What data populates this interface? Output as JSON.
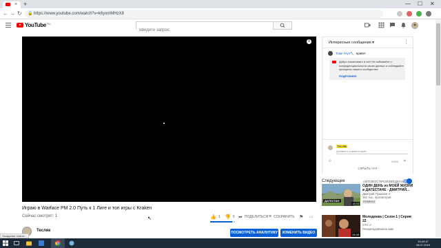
{
  "browser": {
    "url": "https://www.youtube.com/watch?v=k6yxmMHzX8",
    "new_tab": "+",
    "tab_close": "×",
    "nav": {
      "back": "←",
      "forward": "→",
      "reload": "↻",
      "lock": "🔒"
    },
    "window": {
      "minimize": "—",
      "maximize": "☐",
      "close": "✕"
    }
  },
  "youtube": {
    "logo_text": "YouTube",
    "logo_region": "RU",
    "search_placeholder": "Введите запрос"
  },
  "video": {
    "title": "Играю в Warface РМ 2.0 Путь к 1 Лиге и топ игры с Kraken",
    "viewers": "Сейчас смотрят: 1",
    "likes": "1",
    "dislikes": "0",
    "like_ratio": 0.9,
    "share": "ПОДЕЛИТЬСЯ",
    "save": "СОХРАНИТЬ",
    "info": "i"
  },
  "channel": {
    "name": "Тесляк",
    "analytics_button": "ПОСМОТРЕТЬ АНАЛИТИКУ",
    "edit_button": "ИЗМЕНИТЬ ВИДЕО"
  },
  "chat": {
    "header": "Интересные сообщения ▾",
    "more": "⋮",
    "message": {
      "author": "Тоже Глуп🔧",
      "text": "привет"
    },
    "welcome_text": "Добро пожаловать в чат! Не забывайте о конфиденциальности своих данных и соблюдайте принципы нашего сообщества.",
    "welcome_more": "ПОДРОБНЕЕ",
    "input_user": "Тесляк",
    "input_placeholder": "Добавить комментарий",
    "counter": "0/200",
    "hide": "СКРЫТЬ ЧАТ"
  },
  "upnext": {
    "label": "Следующее",
    "autoplay": "АВТОВОСПРОИЗВЕДЕНИЕ",
    "items": [
      {
        "title": "ОДИН ДЕНЬ из МОЕЙ ЖИЗНИ в ДАГЕСТАНЕ - ДМИТРИЙ...",
        "channel": "Дмитрий Пушкаев ✔",
        "views": "151 тыс. просмотров",
        "badge": "Новинка",
        "duration": "14:03",
        "thumb_text": "ДАГЕСТАН",
        "dots": "⋮"
      },
      {
        "title": "Молодежка | Сезон 1 | Серия 22",
        "channel": "СТС ✔",
        "views": "Рекомендованное вам",
        "badge": "",
        "duration": "44:08",
        "thumb_text": "",
        "dots": "⋮"
      }
    ]
  },
  "statusbar": "Ожидание ответа...",
  "clock": {
    "time": "15:29:47",
    "date": "28.07.2019"
  },
  "colors": {
    "brand_red": "#ff0000",
    "accent_blue": "#065fd4",
    "taskbar": "#1c2a3a"
  }
}
